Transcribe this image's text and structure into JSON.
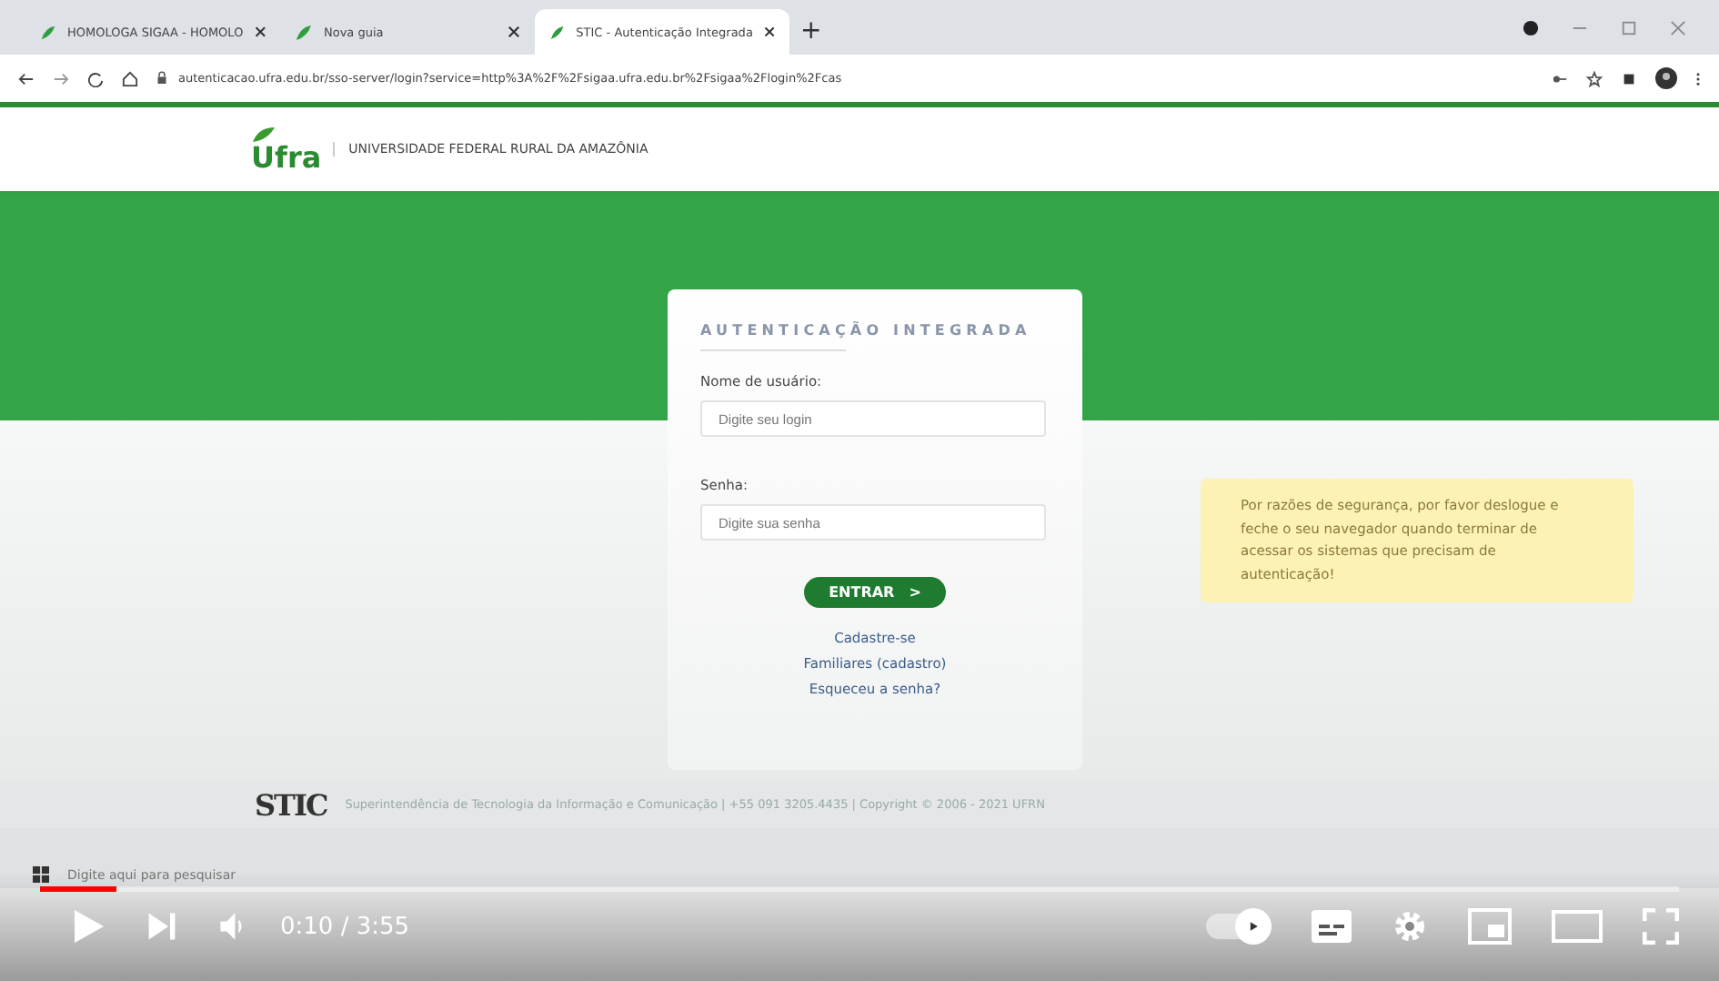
{
  "browser": {
    "tabs": [
      {
        "title": "HOMOLOGA SIGAA - HOMOLO",
        "selected": false
      },
      {
        "title": "Nova guia",
        "selected": false
      },
      {
        "title": "STIC - Autenticação Integrada",
        "selected": true
      }
    ],
    "new_tab": "+",
    "address": "autenticacao.ufra.edu.br/sso-server/login?service=http%3A%2F%2Fsigaa.ufra.edu.br%2Fsigaa%2Flogin%2Fcas"
  },
  "header": {
    "logo": "Ufra",
    "institution": "UNIVERSIDADE FEDERAL RURAL DA AMAZÔNIA"
  },
  "login": {
    "title": "AUTENTICAÇÃO INTEGRADA",
    "fields": [
      {
        "label": "Nome de usuário:",
        "placeholder": "Digite seu login"
      },
      {
        "label": "Senha:",
        "placeholder": "Digite sua senha"
      }
    ],
    "button": "ENTRAR",
    "button_icon": ">",
    "links": [
      "Cadastre-se",
      "Familiares (cadastro)",
      "Esqueceu a senha?"
    ]
  },
  "notice": "Por razões de segurança, por favor deslogue e feche o seu navegador quando terminar de acessar os sistemas que precisam de autenticação!",
  "footer": {
    "logo": "STIC",
    "text": "Superintendência de Tecnologia da Informação e Comunicação | +55 091 3205.4435 | Copyright © 2006 - 2021 UFRN"
  },
  "taskbar": {
    "search_placeholder": "Digite aqui para pesquisar"
  },
  "player": {
    "time": "0:10 / 3:55",
    "progress": {
      "level": 0.047
    },
    "autoplay": true
  }
}
